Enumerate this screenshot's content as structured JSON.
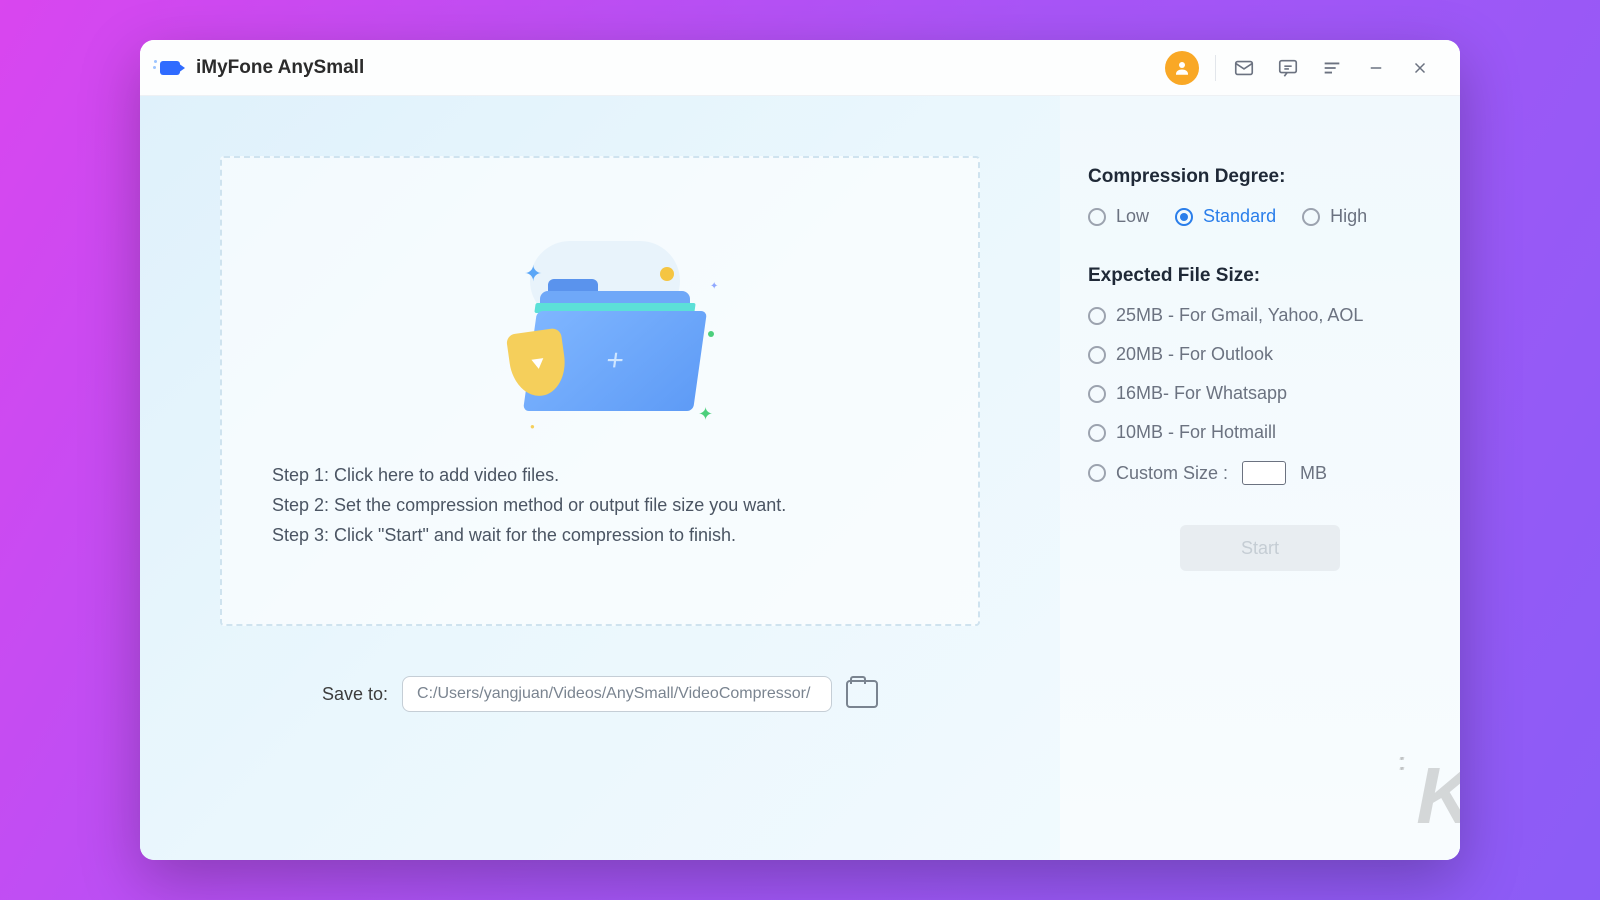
{
  "app": {
    "title": "iMyFone AnySmall"
  },
  "dropzone": {
    "step1": "Step 1: Click here to add video files.",
    "step2": "Step 2: Set the compression method or output file size you want.",
    "step3": "Step 3: Click \"Start\" and wait for the compression to finish."
  },
  "save": {
    "label": "Save to:",
    "path": "C:/Users/yangjuan/Videos/AnySmall/VideoCompressor/"
  },
  "side": {
    "compression_title": "Compression Degree:",
    "degrees": {
      "low": "Low",
      "standard": "Standard",
      "high": "High"
    },
    "expected_title": "Expected File Size:",
    "sizes": {
      "s25": "25MB - For Gmail, Yahoo, AOL",
      "s20": "20MB - For Outlook",
      "s16": "16MB- For Whatsapp",
      "s10": "10MB - For Hotmaill",
      "custom_label": "Custom Size :",
      "custom_unit": "MB"
    },
    "start": "Start"
  }
}
